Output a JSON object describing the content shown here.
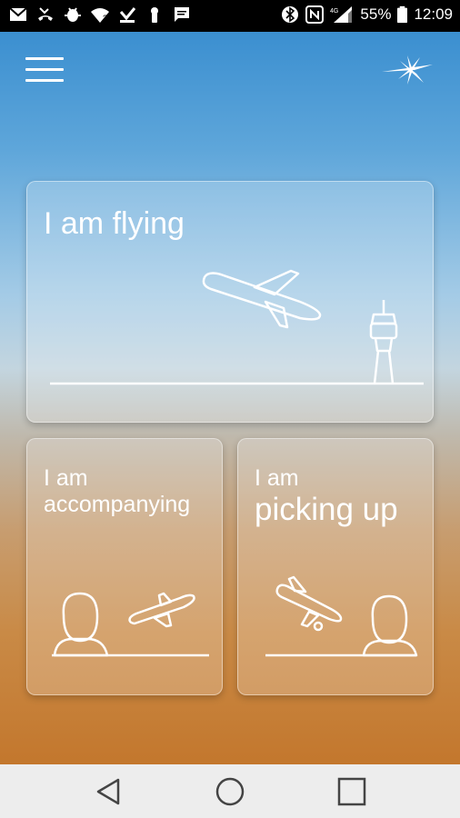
{
  "status_bar": {
    "icons_left": [
      "gmail-icon",
      "missed-call-icon",
      "android-debug-icon",
      "wifi-question-icon",
      "download-icon",
      "keyhole-icon",
      "message-icon"
    ],
    "icons_right": [
      "bluetooth-icon",
      "nfc-icon",
      "signal-4g-icon",
      "battery-icon"
    ],
    "battery": "55%",
    "time": "12:09"
  },
  "header": {
    "menu_icon": "hamburger-menu-icon",
    "logo_icon": "airline-star-logo-icon"
  },
  "cards": {
    "flying": {
      "line1": "I am flying"
    },
    "accompanying": {
      "line1": "I am",
      "line2": "accompanying"
    },
    "picking_up": {
      "line1": "I am",
      "line2": "picking up"
    }
  },
  "nav_bar": {
    "back_icon": "back-triangle-icon",
    "home_icon": "home-circle-icon",
    "recents_icon": "recents-square-icon"
  }
}
